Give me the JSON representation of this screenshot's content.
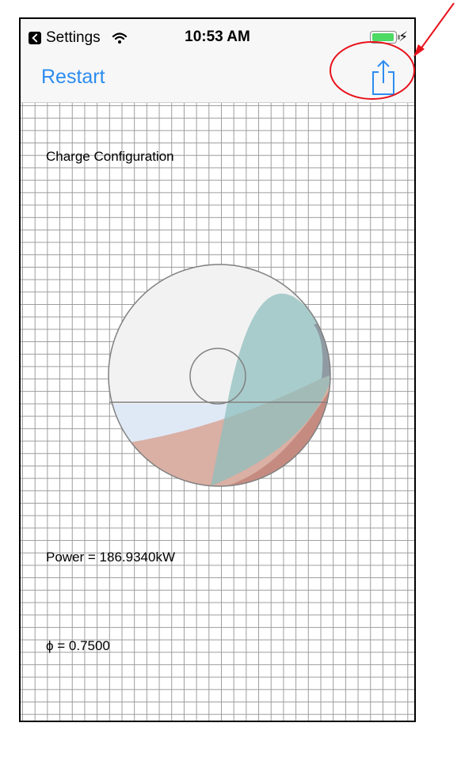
{
  "status_bar": {
    "back_app": "Settings",
    "time": "10:53 AM",
    "battery_level": 0.95,
    "charging_icon": "bolt-icon",
    "wifi_icon": "wifi-icon"
  },
  "nav": {
    "restart_label": "Restart",
    "share_icon": "share-icon"
  },
  "content": {
    "title": "Charge Configuration",
    "power": "Power = 186.9340kW",
    "phi": "ϕ = 0.7500"
  },
  "colors": {
    "accent": "#2d8cf0",
    "annotation": "#e8121b",
    "battery": "#4cd964"
  }
}
